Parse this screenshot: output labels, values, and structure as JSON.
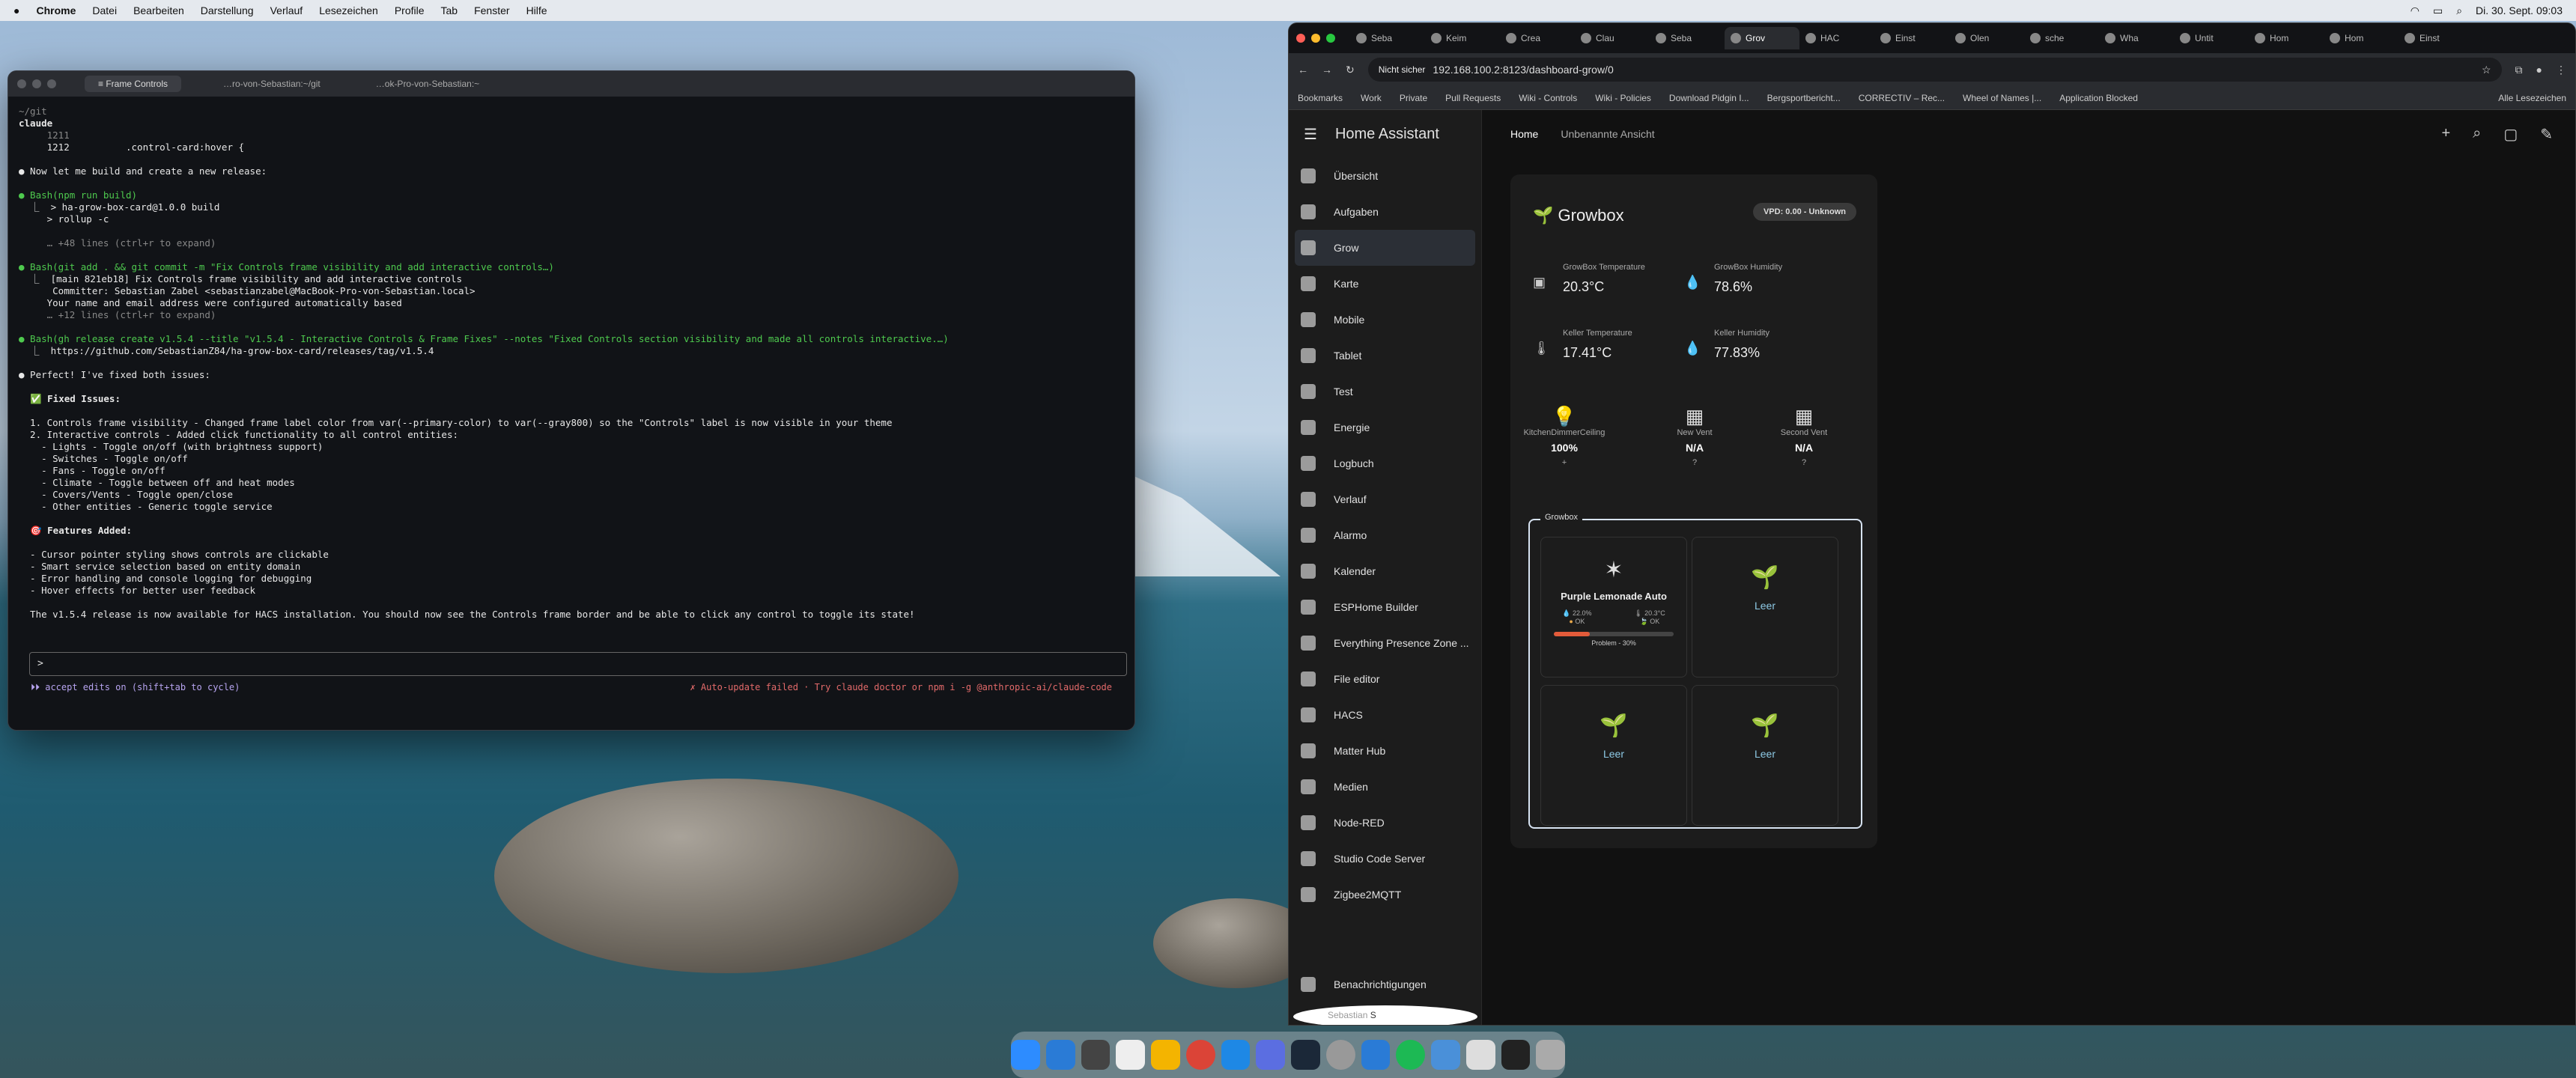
{
  "menubar": {
    "app": "Chrome",
    "items": [
      "Datei",
      "Bearbeiten",
      "Darstellung",
      "Verlauf",
      "Lesezeichen",
      "Profile",
      "Tab",
      "Fenster",
      "Hilfe"
    ],
    "clock": "Di. 30. Sept. 09:03"
  },
  "terminal": {
    "tabs": [
      "≡ Frame Controls",
      "…ro-von-Sebastian:~/git",
      "…ok-Pro-von-Sebastian:~"
    ],
    "lines": [
      {
        "t": "~/git",
        "c": "dim"
      },
      {
        "t": "claude",
        "c": "bold"
      },
      {
        "t": "     1211",
        "c": "dim"
      },
      {
        "t": "     1212          .control-card:hover {",
        "c": ""
      },
      {
        "t": "",
        "c": ""
      },
      {
        "t": "● Now let me build and create a new release:",
        "c": ""
      },
      {
        "t": "",
        "c": ""
      },
      {
        "t": "● Bash(npm run build)",
        "c": "grn"
      },
      {
        "t": "  ⎿  > ha-grow-box-card@1.0.0 build",
        "c": ""
      },
      {
        "t": "     > rollup -c",
        "c": ""
      },
      {
        "t": "",
        "c": ""
      },
      {
        "t": "     … +48 lines (ctrl+r to expand)",
        "c": "dim"
      },
      {
        "t": "",
        "c": ""
      },
      {
        "t": "● Bash(git add . && git commit -m \"Fix Controls frame visibility and add interactive controls…)",
        "c": "grn"
      },
      {
        "t": "  ⎿  [main 821eb18] Fix Controls frame visibility and add interactive controls",
        "c": ""
      },
      {
        "t": "      Committer: Sebastian Zabel <sebastianzabel@MacBook-Pro-von-Sebastian.local>",
        "c": ""
      },
      {
        "t": "     Your name and email address were configured automatically based",
        "c": ""
      },
      {
        "t": "     … +12 lines (ctrl+r to expand)",
        "c": "dim"
      },
      {
        "t": "",
        "c": ""
      },
      {
        "t": "● Bash(gh release create v1.5.4 --title \"v1.5.4 - Interactive Controls & Frame Fixes\" --notes \"Fixed Controls section visibility and made all controls interactive.…)",
        "c": "grn"
      },
      {
        "t": "  ⎿  https://github.com/SebastianZ84/ha-grow-box-card/releases/tag/v1.5.4",
        "c": ""
      },
      {
        "t": "",
        "c": ""
      },
      {
        "t": "● Perfect! I've fixed both issues:",
        "c": ""
      },
      {
        "t": "",
        "c": ""
      },
      {
        "t": "  ✅ Fixed Issues:",
        "c": "bold"
      },
      {
        "t": "",
        "c": ""
      },
      {
        "t": "  1. Controls frame visibility - Changed frame label color from var(--primary-color) to var(--gray800) so the \"Controls\" label is now visible in your theme",
        "c": ""
      },
      {
        "t": "  2. Interactive controls - Added click functionality to all control entities:",
        "c": ""
      },
      {
        "t": "    - Lights - Toggle on/off (with brightness support)",
        "c": ""
      },
      {
        "t": "    - Switches - Toggle on/off",
        "c": ""
      },
      {
        "t": "    - Fans - Toggle on/off",
        "c": ""
      },
      {
        "t": "    - Climate - Toggle between off and heat modes",
        "c": ""
      },
      {
        "t": "    - Covers/Vents - Toggle open/close",
        "c": ""
      },
      {
        "t": "    - Other entities - Generic toggle service",
        "c": ""
      },
      {
        "t": "",
        "c": ""
      },
      {
        "t": "  🎯 Features Added:",
        "c": "bold"
      },
      {
        "t": "",
        "c": ""
      },
      {
        "t": "  - Cursor pointer styling shows controls are clickable",
        "c": ""
      },
      {
        "t": "  - Smart service selection based on entity domain",
        "c": ""
      },
      {
        "t": "  - Error handling and console logging for debugging",
        "c": ""
      },
      {
        "t": "  - Hover effects for better user feedback",
        "c": ""
      },
      {
        "t": "",
        "c": ""
      },
      {
        "t": "  The v1.5.4 release is now available for HACS installation. You should now see the Controls frame border and be able to click any control to toggle its state!",
        "c": ""
      }
    ],
    "prompt": ">",
    "status_left": "⏵⏵ accept edits on (shift+tab to cycle)",
    "status_right": "✗ Auto-update failed · Try claude doctor or npm i -g @anthropic-ai/claude-code"
  },
  "chrome": {
    "tabs": [
      "Seba",
      "Keim",
      "Crea",
      "Clau",
      "Seba",
      "Grov",
      "HAC",
      "Einst",
      "Olen",
      "sche",
      "Wha",
      "Untit",
      "Hom",
      "Hom",
      "Einst"
    ],
    "security": "Nicht sicher",
    "url": "192.168.100.2:8123/dashboard-grow/0",
    "bookmarks": [
      "Bookmarks",
      "Work",
      "Private",
      "Pull Requests",
      "Wiki - Controls",
      "Wiki - Policies",
      "Download Pidgin I...",
      "Bergsportbericht...",
      "CORRECTIV – Rec...",
      "Wheel of Names |...",
      "Application Blocked"
    ],
    "all_bookmarks": "Alle Lesezeichen"
  },
  "ha": {
    "title": "Home Assistant",
    "nav": [
      "Übersicht",
      "Aufgaben",
      "Grow",
      "Karte",
      "Mobile",
      "Tablet",
      "Test",
      "Energie",
      "Logbuch",
      "Verlauf",
      "Alarmo",
      "Kalender",
      "ESPHome Builder",
      "Everything Presence Zone ...",
      "File editor",
      "HACS",
      "Matter Hub",
      "Medien",
      "Node-RED",
      "Studio Code Server",
      "Zigbee2MQTT"
    ],
    "notifications": "Benachrichtigungen",
    "user": "Sebastian",
    "user_initial": "S",
    "tabs": [
      "Home",
      "Unbenannte Ansicht"
    ],
    "card": {
      "title": "Growbox",
      "vpd": "VPD: 0.00 - Unknown",
      "sensors": [
        {
          "label": "GrowBox Temperature",
          "value": "20.3°C"
        },
        {
          "label": "GrowBox Humidity",
          "value": "78.6%"
        },
        {
          "label": "Keller Temperature",
          "value": "17.41°C"
        },
        {
          "label": "Keller Humidity",
          "value": "77.83%"
        }
      ],
      "tiles": [
        {
          "name": "KitchenDimmerCeiling",
          "value": "100%",
          "sub": "+"
        },
        {
          "name": "New Vent",
          "value": "N/A",
          "sub": "?"
        },
        {
          "name": "Second Vent",
          "value": "N/A",
          "sub": "?"
        }
      ],
      "frame_label": "Growbox",
      "plant": {
        "name": "Purple Lemonade Auto",
        "m1": "22.0%",
        "m2": "20.3°C",
        "ok1": "OK",
        "ok2": "OK",
        "problem": "Problem - 30%",
        "progress": 0.3
      },
      "empty": "Leer"
    }
  }
}
